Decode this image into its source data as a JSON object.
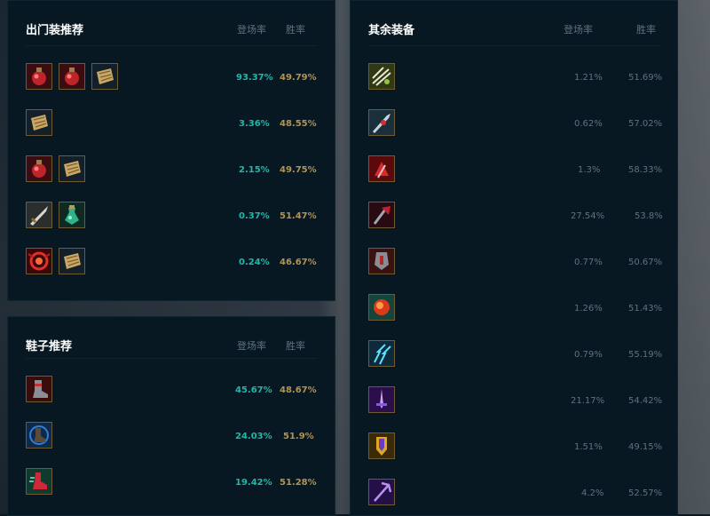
{
  "starter": {
    "title": "出门装推荐",
    "col_pick": "登场率",
    "col_win": "胜率",
    "rows": [
      {
        "icons": [
          "health-potion-icon",
          "health-potion-icon",
          "scroll-icon"
        ],
        "pick": "93.37%",
        "win": "49.79%"
      },
      {
        "icons": [
          "scroll-icon"
        ],
        "pick": "3.36%",
        "win": "48.55%"
      },
      {
        "icons": [
          "health-potion-icon",
          "scroll-icon"
        ],
        "pick": "2.15%",
        "win": "49.75%"
      },
      {
        "icons": [
          "long-sword-icon",
          "refillable-potion-icon"
        ],
        "pick": "0.37%",
        "win": "51.47%"
      },
      {
        "icons": [
          "crimson-relic-icon",
          "scroll-icon"
        ],
        "pick": "0.24%",
        "win": "46.67%"
      }
    ]
  },
  "boots": {
    "title": "鞋子推荐",
    "col_pick": "登场率",
    "col_win": "胜率",
    "rows": [
      {
        "icons": [
          "plated-boots-icon"
        ],
        "pick": "45.67%",
        "win": "48.67%"
      },
      {
        "icons": [
          "mercury-boots-icon"
        ],
        "pick": "24.03%",
        "win": "51.9%"
      },
      {
        "icons": [
          "swift-boots-icon"
        ],
        "pick": "19.42%",
        "win": "51.28%"
      }
    ]
  },
  "other": {
    "title": "其余装备",
    "col_pick": "登场率",
    "col_win": "胜率",
    "rows": [
      {
        "icon": "green-claw-icon",
        "pick": "1.21%",
        "win": "51.69%"
      },
      {
        "icon": "silver-blade-icon",
        "pick": "0.62%",
        "win": "57.02%"
      },
      {
        "icon": "red-hydra-icon",
        "pick": "1.3%",
        "win": "58.33%"
      },
      {
        "icon": "dark-axe-icon",
        "pick": "27.54%",
        "win": "53.8%"
      },
      {
        "icon": "grey-cleaver-icon",
        "pick": "0.77%",
        "win": "50.67%"
      },
      {
        "icon": "fire-orb-icon",
        "pick": "1.26%",
        "win": "51.43%"
      },
      {
        "icon": "lightning-claw-icon",
        "pick": "0.79%",
        "win": "55.19%"
      },
      {
        "icon": "purple-sword-icon",
        "pick": "21.17%",
        "win": "54.42%"
      },
      {
        "icon": "gold-shield-icon",
        "pick": "1.51%",
        "win": "49.15%"
      },
      {
        "icon": "purple-trident-icon",
        "pick": "4.2%",
        "win": "52.57%"
      }
    ]
  },
  "colors": {
    "pick_bright": "#1fb8aa",
    "win_bright": "#b49350",
    "dim_text": "#5d7380",
    "panel_bg": "#081822"
  }
}
